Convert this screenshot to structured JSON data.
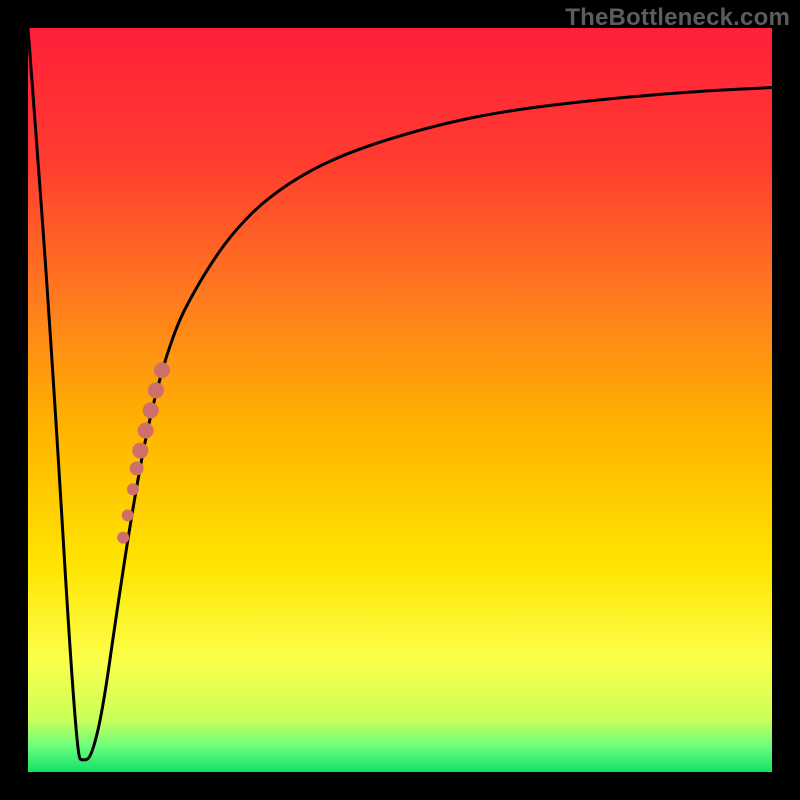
{
  "watermark": "TheBottleneck.com",
  "colors": {
    "frame": "#000000",
    "gradient_stops": [
      {
        "offset": 0.0,
        "color": "#ff1f3a"
      },
      {
        "offset": 0.18,
        "color": "#ff3c2f"
      },
      {
        "offset": 0.36,
        "color": "#ff7a1f"
      },
      {
        "offset": 0.54,
        "color": "#ffb400"
      },
      {
        "offset": 0.72,
        "color": "#ffe400"
      },
      {
        "offset": 0.85,
        "color": "#fbff4a"
      },
      {
        "offset": 0.93,
        "color": "#c9ff5a"
      },
      {
        "offset": 0.965,
        "color": "#6dff7a"
      },
      {
        "offset": 1.0,
        "color": "#11e06a"
      }
    ],
    "curve": "#000000",
    "marker_fill": "#cf6f6a",
    "marker_stroke": "#bf5a55"
  },
  "chart_data": {
    "type": "line",
    "title": "",
    "xlabel": "",
    "ylabel": "",
    "xlim": [
      0,
      100
    ],
    "ylim": [
      0,
      100
    ],
    "series": [
      {
        "name": "bottleneck-curve",
        "x": [
          0,
          3,
          6.5,
          7.5,
          8.5,
          10,
          12,
          14,
          16,
          18,
          20,
          22,
          25,
          28,
          32,
          38,
          45,
          55,
          65,
          78,
          90,
          100
        ],
        "y": [
          100,
          60,
          2,
          1.5,
          2,
          8,
          22,
          35,
          46,
          54,
          60,
          64,
          69,
          73,
          77,
          81,
          84,
          87,
          89,
          90.5,
          91.5,
          92
        ]
      }
    ],
    "markers": [
      {
        "name": "highlight-segment",
        "x": 18.0,
        "y": 54.0,
        "r": 8
      },
      {
        "name": "highlight-segment",
        "x": 17.2,
        "y": 51.3,
        "r": 8
      },
      {
        "name": "highlight-segment",
        "x": 16.5,
        "y": 48.6,
        "r": 8
      },
      {
        "name": "highlight-segment",
        "x": 15.8,
        "y": 45.9,
        "r": 8
      },
      {
        "name": "highlight-segment",
        "x": 15.1,
        "y": 43.2,
        "r": 8
      },
      {
        "name": "highlight-segment",
        "x": 14.6,
        "y": 40.8,
        "r": 7
      },
      {
        "name": "highlight-point",
        "x": 14.1,
        "y": 38.0,
        "r": 6
      },
      {
        "name": "highlight-point",
        "x": 13.4,
        "y": 34.5,
        "r": 6
      },
      {
        "name": "highlight-point",
        "x": 12.8,
        "y": 31.5,
        "r": 6
      }
    ]
  }
}
